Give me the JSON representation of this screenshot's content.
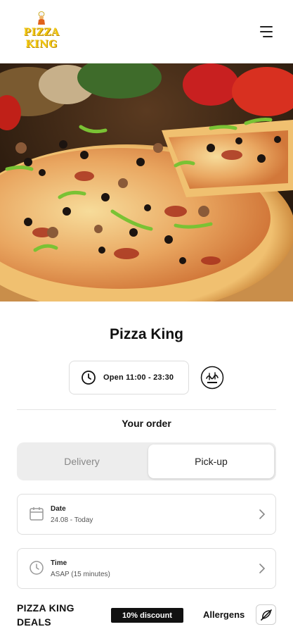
{
  "header": {
    "logo_line1": "PIZZA",
    "logo_line2": "KING",
    "menu_icon": "hamburger-menu-icon"
  },
  "hero": {
    "image": "pizza-photo"
  },
  "restaurant": {
    "name": "Pizza King",
    "hours": "Open 11:00 - 23:30",
    "halal_icon": "halal-badge-icon"
  },
  "order": {
    "heading": "Your order",
    "modes": {
      "delivery": "Delivery",
      "pickup": "Pick-up",
      "selected": "pickup"
    },
    "date": {
      "label": "Date",
      "value": "24.08 - Today"
    },
    "time": {
      "label": "Time",
      "value": "ASAP (15 minutes)"
    }
  },
  "deals": {
    "title": "PIZZA KING DEALS",
    "discount": "10% discount",
    "allergens": "Allergens"
  },
  "colors": {
    "logo": "#f2c80f",
    "badge_bg": "#111111",
    "toggle_bg": "#ededed"
  }
}
